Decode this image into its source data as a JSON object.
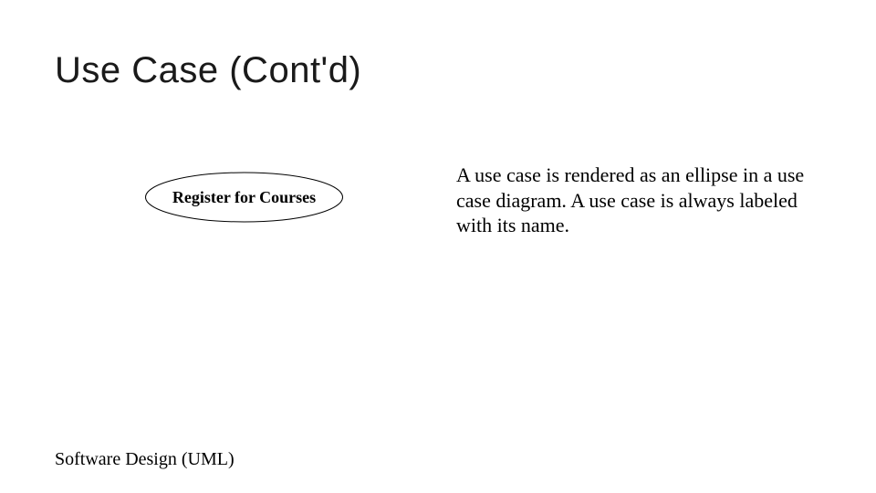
{
  "title": "Use Case (Cont'd)",
  "usecase": {
    "label": "Register for Courses"
  },
  "description": "A use case is rendered as an ellipse in a use case diagram. A use case is always labeled with its name.",
  "footer": "Software Design (UML)"
}
